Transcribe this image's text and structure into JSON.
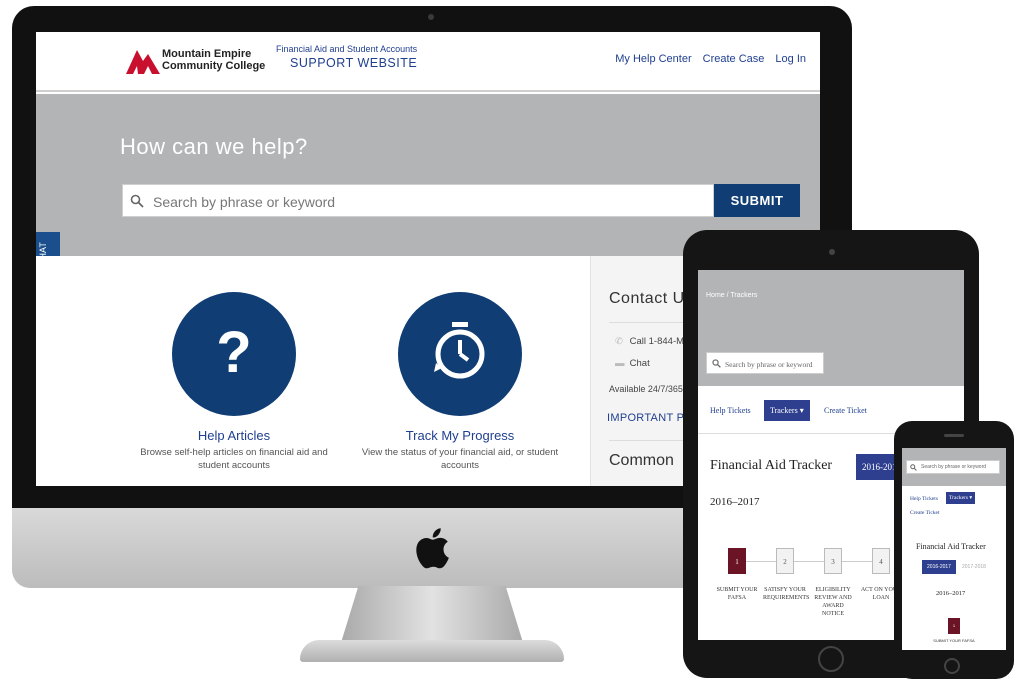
{
  "desktop": {
    "header": {
      "college_name": "Mountain Empire Community College",
      "support_subtitle": "Financial Aid and Student Accounts",
      "support_title": "SUPPORT WEBSITE",
      "nav": [
        "My Help Center",
        "Create Case",
        "Log In"
      ]
    },
    "hero": {
      "title": "How can we help?",
      "search_placeholder": "Search by phrase or keyword",
      "submit_label": "SUBMIT"
    },
    "live_chat": {
      "label": "LIVE CHAT",
      "dots": "•••"
    },
    "cards": [
      {
        "icon": "question-icon",
        "title": "Help Articles",
        "description": "Browse self-help articles on financial aid and student accounts"
      },
      {
        "icon": "stopwatch-icon",
        "title": "Track My Progress",
        "description": "View the status of your financial aid, or student accounts"
      }
    ],
    "contact": {
      "title": "Contact U",
      "call": "Call 1-844-M",
      "chat": "Chat",
      "available": "Available 24/7/365",
      "important": "IMPORTANT PA",
      "common": "Common"
    }
  },
  "tablet": {
    "breadcrumb": "Home / Trackers",
    "search_placeholder": "Search by phrase or keyword",
    "tabs": [
      "Help Tickets",
      "Trackers ▾",
      "Create Ticket"
    ],
    "title": "Financial Aid Tracker",
    "year_button": "2016-201",
    "year": "2016–2017",
    "steps": [
      {
        "number": "1",
        "label": "SUBMIT YOUR FAFSA"
      },
      {
        "number": "2",
        "label": "SATISFY YOUR REQUIREMENTS"
      },
      {
        "number": "3",
        "label": "ELIGIBILITY REVIEW AND AWARD NOTICE"
      },
      {
        "number": "4",
        "label": "ACT ON YOUR LOAN"
      }
    ]
  },
  "phone": {
    "search_placeholder": "Search by phrase or keyword",
    "tabs": [
      "Help Tickets",
      "Trackers ▾",
      "Create Ticket"
    ],
    "title": "Financial Aid Tracker",
    "year_button": "2016-2017",
    "year_alt": "2017-2018",
    "year": "2016–2017",
    "step_number": "1",
    "step_label": "SUBMIT YOUR FAFSA"
  },
  "colors": {
    "brand_navy": "#0f3d74",
    "link_blue": "#1f3f8f",
    "hero_gray": "#b3b4b6",
    "tracker_maroon": "#6a1426",
    "logo_red": "#c8102e"
  }
}
